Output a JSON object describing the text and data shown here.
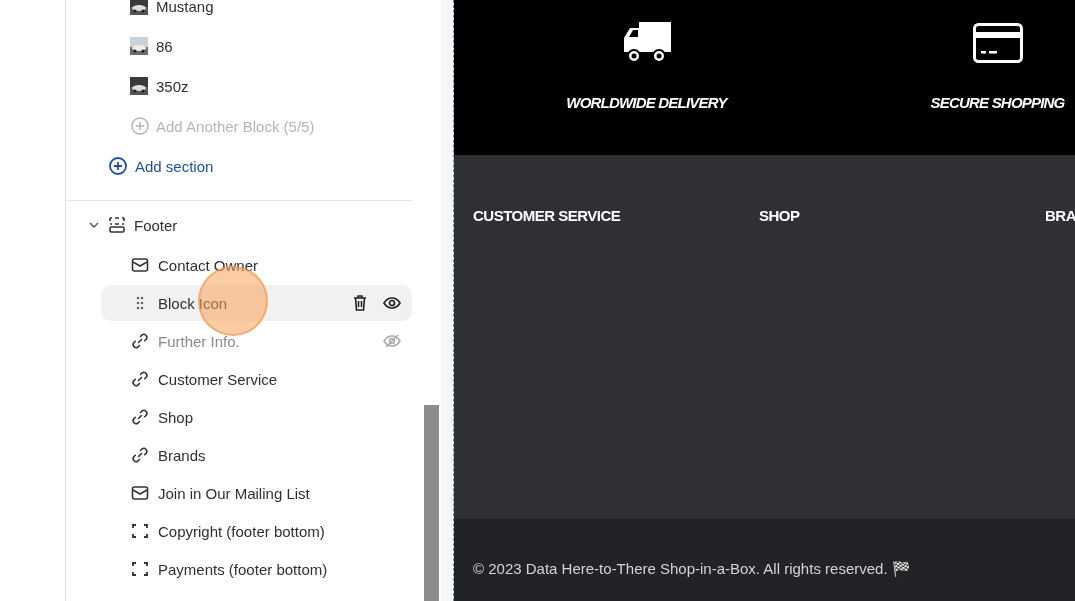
{
  "sidebar": {
    "blocks": [
      {
        "label": "Mustang"
      },
      {
        "label": "86"
      },
      {
        "label": "350z"
      },
      {
        "kind": "add",
        "label": "Add Another Block (5/5)",
        "disabled": true
      }
    ],
    "add_section": "Add section",
    "section": {
      "label": "Footer",
      "expanded": true,
      "children": [
        {
          "kind": "mail",
          "label": "Contact Owner",
          "selected": false,
          "hidden": false
        },
        {
          "kind": "drag",
          "label": "Block Icon",
          "selected": true,
          "hidden": false
        },
        {
          "kind": "link",
          "label": "Further Info.",
          "selected": false,
          "hidden": true
        },
        {
          "kind": "link",
          "label": "Customer Service",
          "selected": false,
          "hidden": false
        },
        {
          "kind": "link",
          "label": "Shop",
          "selected": false,
          "hidden": false
        },
        {
          "kind": "link",
          "label": "Brands",
          "selected": false,
          "hidden": false
        },
        {
          "kind": "mail",
          "label": "Join in Our Mailing List",
          "selected": false,
          "hidden": false
        },
        {
          "kind": "bracket",
          "label": "Copyright (footer bottom)",
          "selected": false,
          "hidden": false
        },
        {
          "kind": "bracket",
          "label": "Payments (footer bottom)",
          "selected": false,
          "hidden": false
        }
      ]
    }
  },
  "preview": {
    "features": [
      {
        "kind": "truck",
        "label": "WORLDWIDE DELIVERY"
      },
      {
        "kind": "card",
        "label": "SECURE SHOPPING"
      }
    ],
    "columns": [
      "CUSTOMER SERVICE",
      "SHOP",
      "BRA"
    ],
    "copyright": "© 2023 Data Here-to-There Shop-in-a-Box. All rights reserved. 🏁"
  }
}
